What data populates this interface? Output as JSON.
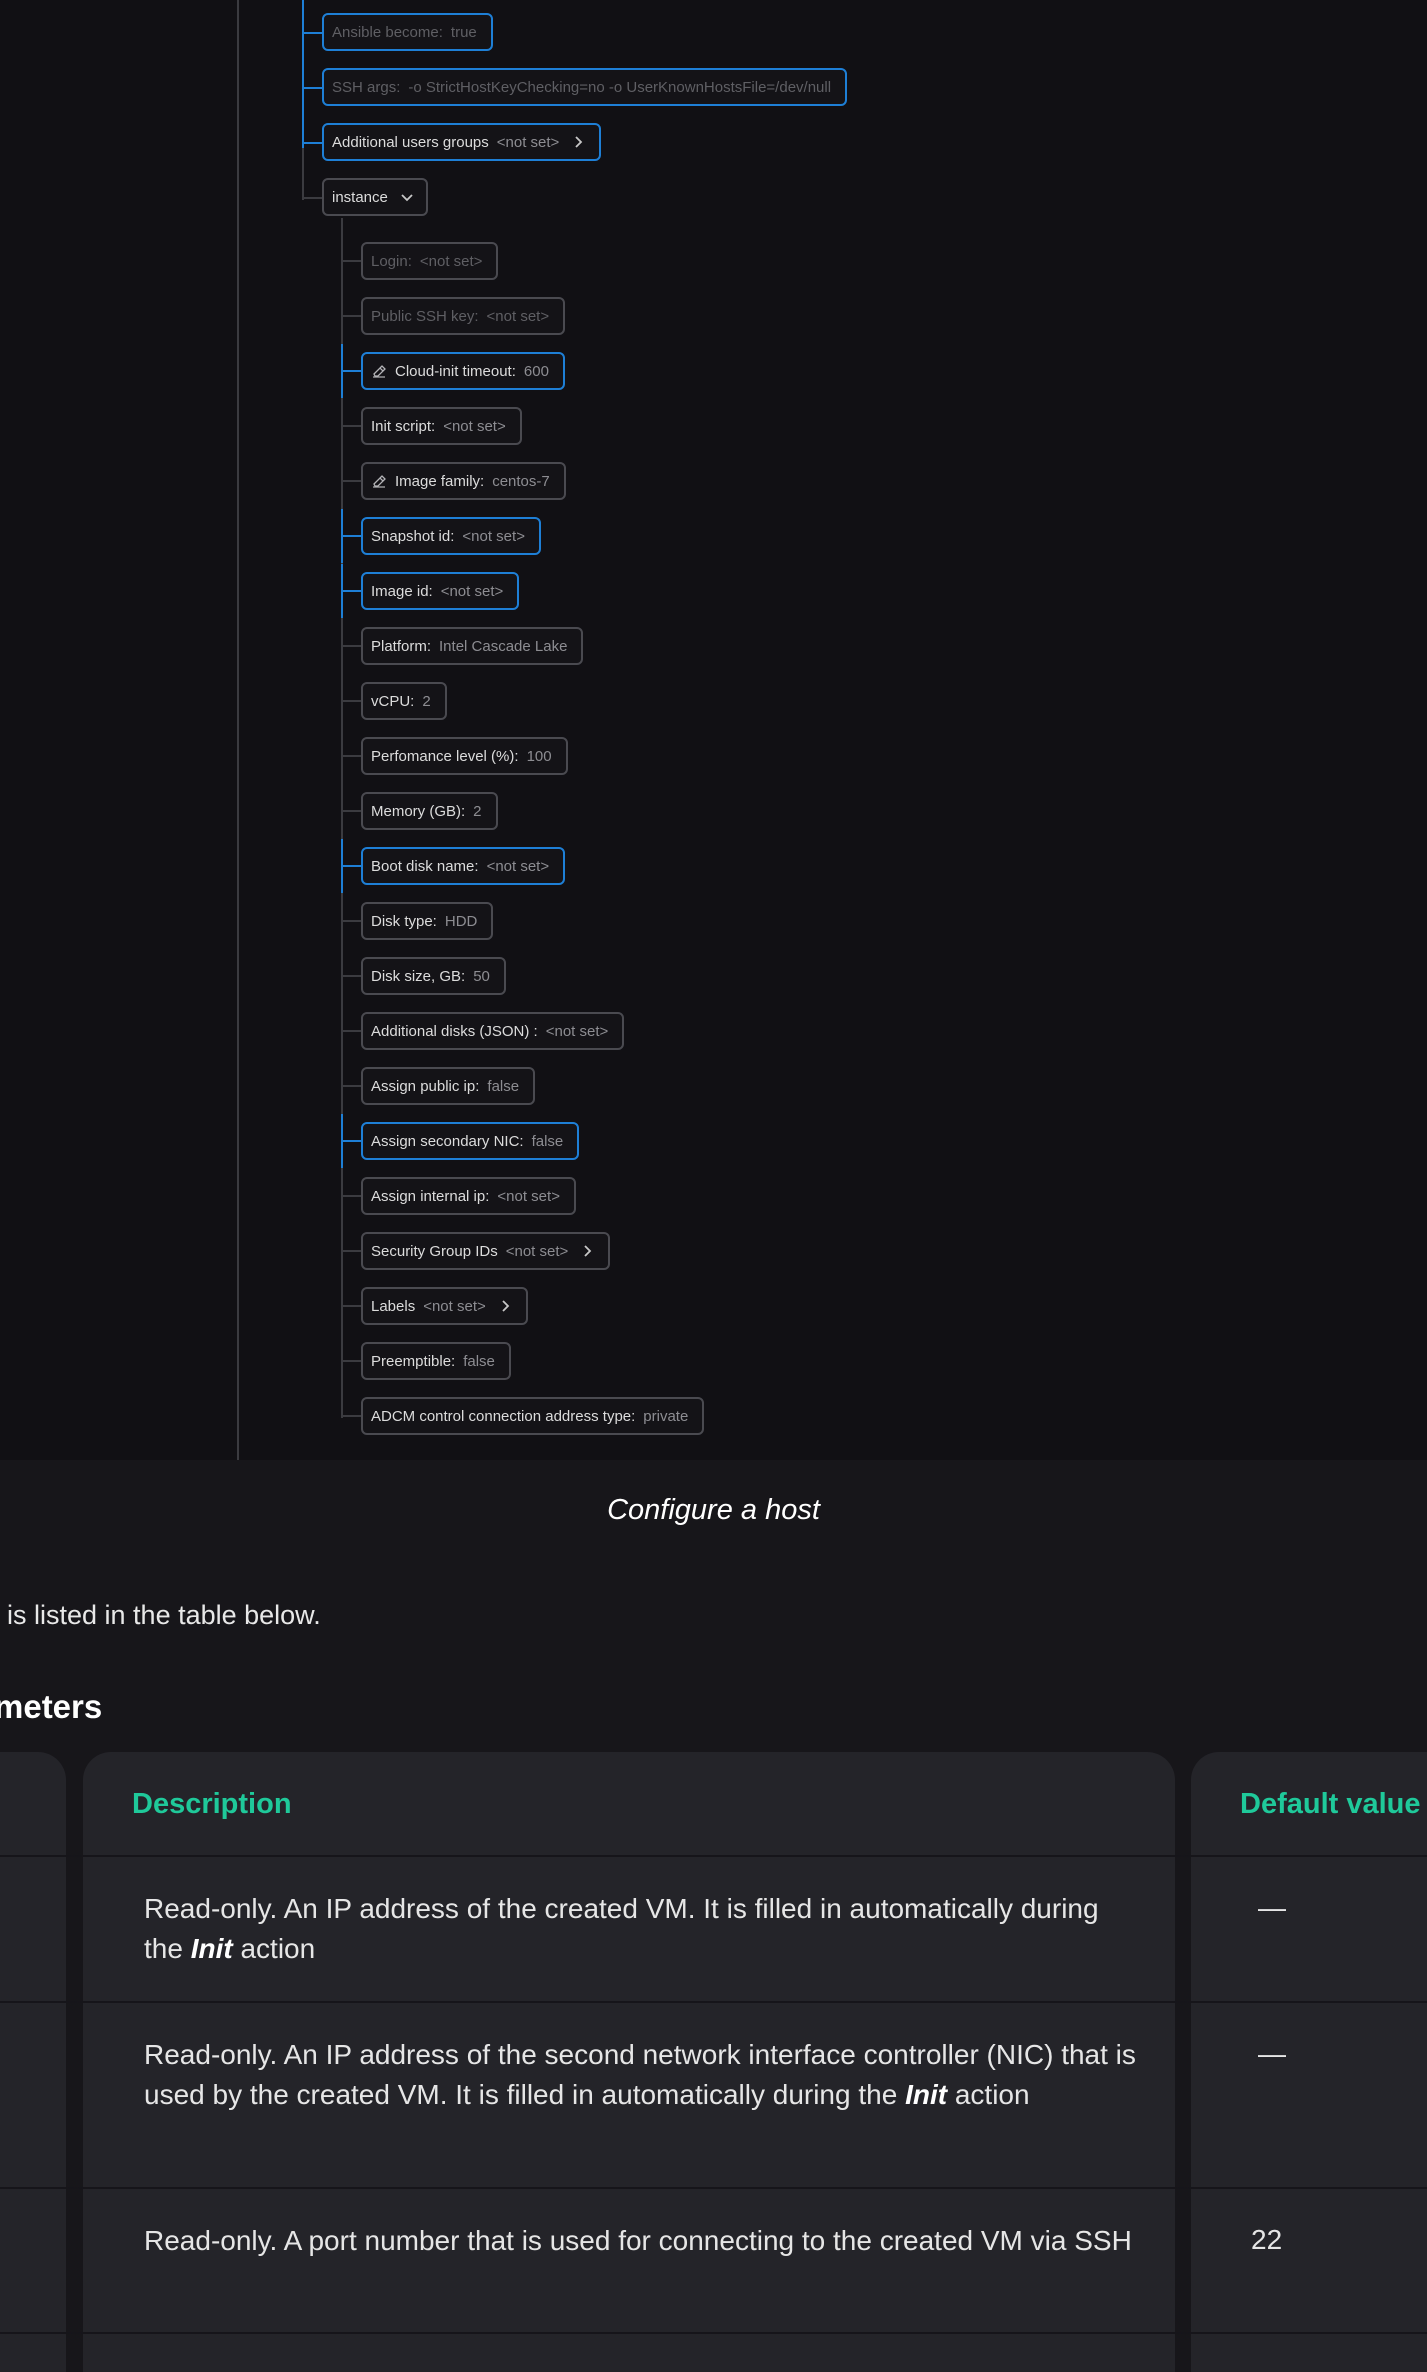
{
  "tree_top": [
    {
      "label": "Ansible become:",
      "value": "true",
      "state": "dim-hl"
    },
    {
      "label": "SSH args:",
      "value": "-o StrictHostKeyChecking=no -o UserKnownHostsFile=/dev/null",
      "state": "dim-hl"
    },
    {
      "label": "Additional users groups",
      "value": "<not set>",
      "state": "hl",
      "chevron": true
    }
  ],
  "instance_toggle": {
    "label": "instance"
  },
  "instance_items": [
    {
      "label": "Login:",
      "value": "<not set>",
      "state": "dim"
    },
    {
      "label": "Public SSH key:",
      "value": "<not set>",
      "state": "dim"
    },
    {
      "label": "Cloud-init timeout:",
      "value": "600",
      "state": "hl",
      "icon": "eraser-icon"
    },
    {
      "label": "Init script:",
      "value": "<not set>",
      "state": "normal"
    },
    {
      "label": "Image family:",
      "value": "centos-7",
      "state": "normal",
      "icon": "eraser-icon"
    },
    {
      "label": "Snapshot id:",
      "value": "<not set>",
      "state": "hl"
    },
    {
      "label": "Image id:",
      "value": "<not set>",
      "state": "hl"
    },
    {
      "label": "Platform:",
      "value": "Intel Cascade Lake",
      "state": "normal"
    },
    {
      "label": "vCPU:",
      "value": "2",
      "state": "normal"
    },
    {
      "label": "Perfomance level (%):",
      "value": "100",
      "state": "normal"
    },
    {
      "label": "Memory (GB):",
      "value": "2",
      "state": "normal"
    },
    {
      "label": "Boot disk name:",
      "value": "<not set>",
      "state": "hl"
    },
    {
      "label": "Disk type:",
      "value": "HDD",
      "state": "normal"
    },
    {
      "label": "Disk size, GB:",
      "value": "50",
      "state": "normal"
    },
    {
      "label": "Additional disks (JSON) :",
      "value": "<not set>",
      "state": "normal"
    },
    {
      "label": "Assign public ip:",
      "value": "false",
      "state": "normal"
    },
    {
      "label": "Assign secondary NIC:",
      "value": "false",
      "state": "hl"
    },
    {
      "label": "Assign internal ip:",
      "value": "<not set>",
      "state": "normal"
    },
    {
      "label": "Security Group IDs",
      "value": "<not set>",
      "state": "normal",
      "chevron": true
    },
    {
      "label": "Labels",
      "value": "<not set>",
      "state": "normal",
      "chevron": true
    },
    {
      "label": "Preemptible:",
      "value": "false",
      "state": "normal"
    },
    {
      "label": "ADCM control connection address type:",
      "value": "private",
      "state": "normal"
    }
  ],
  "caption": "Configure a host",
  "intro_text": "s is listed in the table below.",
  "section_heading": "meters",
  "table": {
    "headers": {
      "description": "Description",
      "default": "Default value"
    },
    "rows": [
      {
        "desc_before": "Read-only. An IP address of the created VM. It is filled in automatically during the ",
        "desc_em": "Init",
        "desc_after": " action",
        "default": "—"
      },
      {
        "desc_before": "Read-only. An IP address of the second network interface controller (NIC) that is used by the created VM. It is filled in automatically during the ",
        "desc_em": "Init",
        "desc_after": " action",
        "default": "—"
      },
      {
        "desc_before": "Read-only. A port number that is used for connecting to the created VM via SSH",
        "desc_em": "",
        "desc_after": "",
        "default": "22"
      }
    ]
  },
  "colors": {
    "highlight": "#1e7fd6",
    "header_accent": "#1fc99a",
    "panel_bg": "#111014",
    "page_bg": "#17161a"
  }
}
